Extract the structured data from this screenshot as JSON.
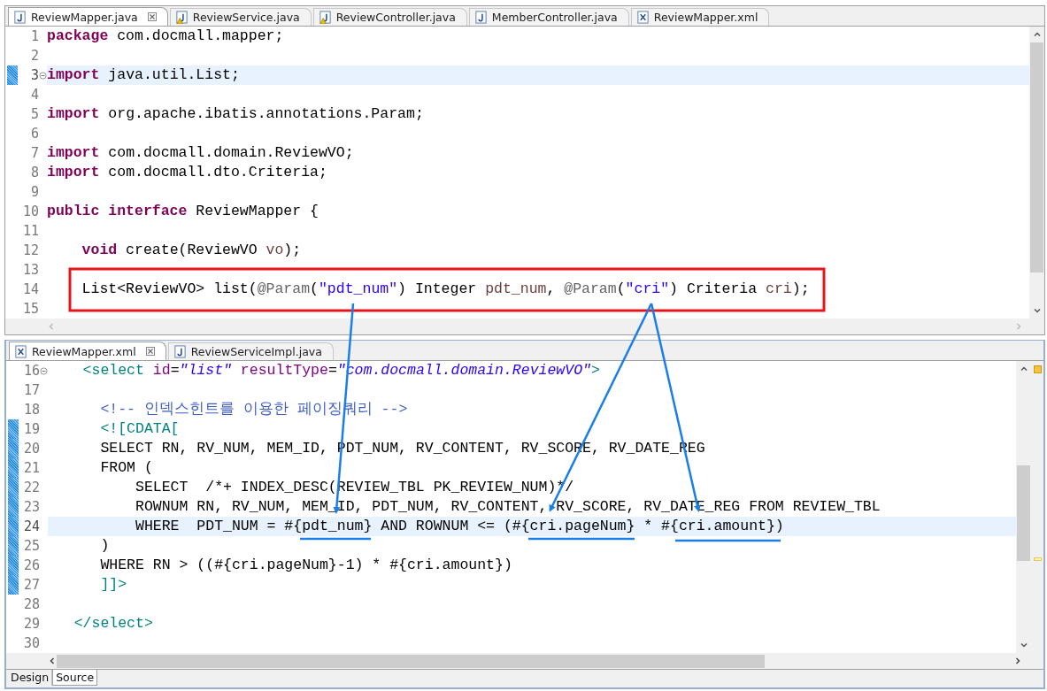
{
  "editors": [
    {
      "tabs": [
        {
          "label": "ReviewMapper.java",
          "kind": "java",
          "selected": true
        },
        {
          "label": "ReviewService.java",
          "kind": "java-warning",
          "selected": false
        },
        {
          "label": "ReviewController.java",
          "kind": "java-warning",
          "selected": false
        },
        {
          "label": "MemberController.java",
          "kind": "java",
          "selected": false
        },
        {
          "label": "ReviewMapper.xml",
          "kind": "xml",
          "selected": false
        }
      ],
      "lines": [
        {
          "number": "1",
          "fold": false,
          "changed": false,
          "current": false,
          "tokens": [
            {
              "text": "package",
              "kind": "kw"
            },
            {
              "text": " com.docmall.mapper;",
              "kind": "plain"
            }
          ]
        },
        {
          "number": "2",
          "fold": false,
          "changed": false,
          "current": false
        },
        {
          "number": "3",
          "fold": true,
          "changed": true,
          "current": true,
          "tokens": [
            {
              "text": "import",
              "kind": "kw"
            },
            {
              "text": " java.util.List;",
              "kind": "plain"
            }
          ]
        },
        {
          "number": "4",
          "fold": false,
          "changed": false,
          "current": false
        },
        {
          "number": "5",
          "fold": false,
          "changed": false,
          "current": false,
          "tokens": [
            {
              "text": "import",
              "kind": "kw"
            },
            {
              "text": " org.apache.ibatis.annotations.Param;",
              "kind": "plain"
            }
          ]
        },
        {
          "number": "6",
          "fold": false,
          "changed": false,
          "current": false
        },
        {
          "number": "7",
          "fold": false,
          "changed": false,
          "current": false,
          "tokens": [
            {
              "text": "import",
              "kind": "kw"
            },
            {
              "text": " com.docmall.domain.ReviewVO;",
              "kind": "plain"
            }
          ]
        },
        {
          "number": "8",
          "fold": false,
          "changed": false,
          "current": false,
          "tokens": [
            {
              "text": "import",
              "kind": "kw"
            },
            {
              "text": " com.docmall.dto.Criteria;",
              "kind": "plain"
            }
          ]
        },
        {
          "number": "9",
          "fold": false,
          "changed": false,
          "current": false
        },
        {
          "number": "10",
          "fold": false,
          "changed": false,
          "current": false,
          "tokens": [
            {
              "text": "public ",
              "kind": "kw"
            },
            {
              "text": "interface",
              "kind": "kw"
            },
            {
              "text": " ReviewMapper {",
              "kind": "plain"
            }
          ]
        },
        {
          "number": "11",
          "fold": false,
          "changed": false,
          "current": false
        },
        {
          "number": "12",
          "fold": false,
          "changed": false,
          "current": false,
          "tokens": [
            {
              "text": "    void",
              "kind": "kw"
            },
            {
              "text": " create(ReviewVO ",
              "kind": "plain"
            },
            {
              "text": "vo",
              "kind": "var"
            },
            {
              "text": ");",
              "kind": "plain"
            }
          ]
        },
        {
          "number": "13",
          "fold": false,
          "changed": false,
          "current": false
        },
        {
          "number": "14",
          "fold": false,
          "changed": false,
          "current": false,
          "tokens": [
            {
              "text": "    List<ReviewVO> list(",
              "kind": "plain"
            },
            {
              "text": "@Param",
              "kind": "ann"
            },
            {
              "text": "(",
              "kind": "plain"
            },
            {
              "text": "\"pdt_num\"",
              "kind": "str"
            },
            {
              "text": ") Integer ",
              "kind": "plain"
            },
            {
              "text": "pdt_num",
              "kind": "var"
            },
            {
              "text": ", ",
              "kind": "plain"
            },
            {
              "text": "@Param",
              "kind": "ann"
            },
            {
              "text": "(",
              "kind": "plain"
            },
            {
              "text": "\"cri\"",
              "kind": "str"
            },
            {
              "text": ") Criteria ",
              "kind": "plain"
            },
            {
              "text": "cri",
              "kind": "var"
            },
            {
              "text": ");",
              "kind": "plain"
            }
          ]
        },
        {
          "number": "15",
          "fold": false,
          "changed": false,
          "current": false
        }
      ]
    },
    {
      "tabs": [
        {
          "label": "ReviewMapper.xml",
          "kind": "xml",
          "selected": true
        },
        {
          "label": "ReviewServiceImpl.java",
          "kind": "java",
          "selected": false
        }
      ],
      "lines": [
        {
          "number": "16",
          "fold": true,
          "changed": false,
          "current": false,
          "tokens": [
            {
              "text": "    <select",
              "kind": "tag"
            },
            {
              "text": " id",
              "kind": "attr"
            },
            {
              "text": "=",
              "kind": "plain"
            },
            {
              "text": "\"list\"",
              "kind": "val"
            },
            {
              "text": " resultType",
              "kind": "attr"
            },
            {
              "text": "=",
              "kind": "plain"
            },
            {
              "text": "\"com.docmall.domain.ReviewVO\"",
              "kind": "val"
            },
            {
              "text": ">",
              "kind": "tag"
            }
          ]
        },
        {
          "number": "17",
          "fold": false,
          "changed": false,
          "current": false
        },
        {
          "number": "18",
          "fold": false,
          "changed": false,
          "current": false,
          "tokens": [
            {
              "text": "      <!-- 인덱스힌트를 이용한 페이징쿼리 -->",
              "kind": "com"
            }
          ]
        },
        {
          "number": "19",
          "fold": false,
          "changed": true,
          "current": false,
          "tokens": [
            {
              "text": "      <![CDATA[",
              "kind": "tag"
            }
          ]
        },
        {
          "number": "20",
          "fold": false,
          "changed": true,
          "current": false,
          "tokens": [
            {
              "text": "      SELECT RN, RV_NUM, MEM_ID, PDT_NUM, RV_CONTENT, RV_SCORE, RV_DATE_REG",
              "kind": "plain"
            }
          ]
        },
        {
          "number": "21",
          "fold": false,
          "changed": true,
          "current": false,
          "tokens": [
            {
              "text": "      FROM (",
              "kind": "plain"
            }
          ]
        },
        {
          "number": "22",
          "fold": false,
          "changed": true,
          "current": false,
          "tokens": [
            {
              "text": "          SELECT  /*+ INDEX_DESC(REVIEW_TBL PK_REVIEW_NUM)*/",
              "kind": "plain"
            }
          ]
        },
        {
          "number": "23",
          "fold": false,
          "changed": true,
          "current": false,
          "tokens": [
            {
              "text": "          ROWNUM RN, RV_NUM, MEM_ID, PDT_NUM, RV_CONTENT, RV_SCORE, RV_DATE_REG FROM REVIEW_TBL",
              "kind": "plain"
            }
          ]
        },
        {
          "number": "24",
          "fold": false,
          "changed": true,
          "current": true,
          "tokens": [
            {
              "text": "          WHERE  PDT_NUM = #{pdt_num} AND ROWNUM <= (#{cri.pageNum} * #{cri.amount})",
              "kind": "plain"
            }
          ]
        },
        {
          "number": "25",
          "fold": false,
          "changed": true,
          "current": false,
          "tokens": [
            {
              "text": "      )",
              "kind": "plain"
            }
          ]
        },
        {
          "number": "26",
          "fold": false,
          "changed": true,
          "current": false,
          "tokens": [
            {
              "text": "      WHERE RN > ((#{cri.pageNum}-1) * #{cri.amount})",
              "kind": "plain"
            }
          ]
        },
        {
          "number": "27",
          "fold": false,
          "changed": true,
          "current": false,
          "tokens": [
            {
              "text": "      ]]>",
              "kind": "tag"
            }
          ]
        },
        {
          "number": "28",
          "fold": false,
          "changed": false,
          "current": false
        },
        {
          "number": "29",
          "fold": false,
          "changed": false,
          "current": false,
          "tokens": [
            {
              "text": "   </select>",
              "kind": "tag"
            }
          ]
        },
        {
          "number": "30",
          "fold": false,
          "changed": false,
          "current": false
        }
      ],
      "bottom_tabs": [
        {
          "label": "Design",
          "selected": false
        },
        {
          "label": "Source",
          "selected": true
        }
      ]
    }
  ]
}
